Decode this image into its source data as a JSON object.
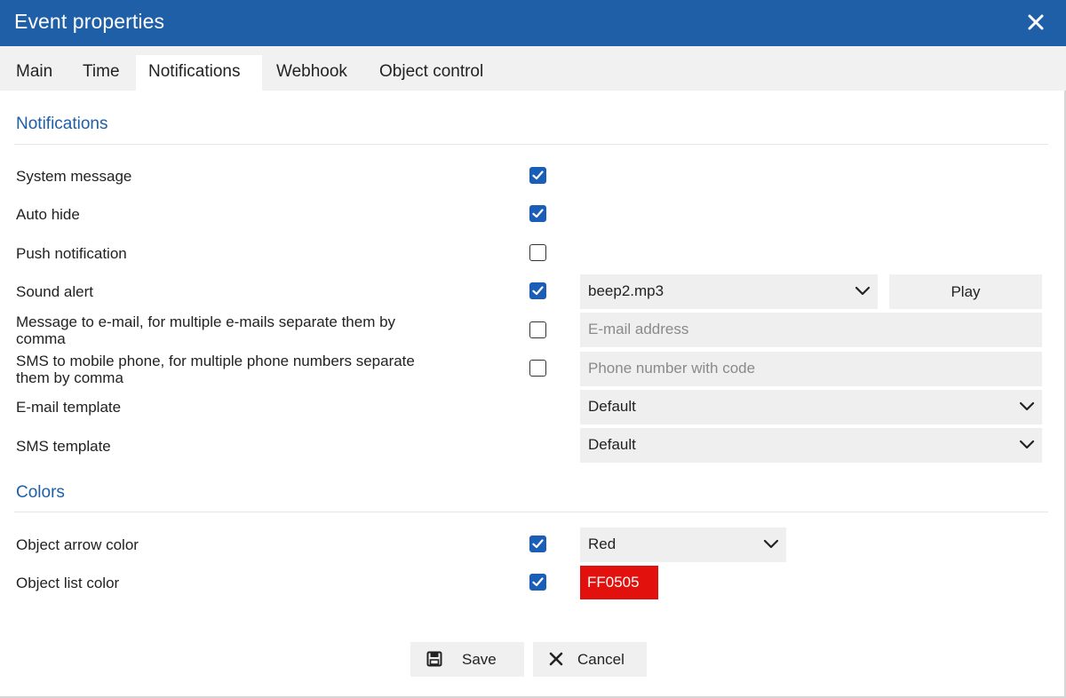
{
  "window": {
    "title": "Event properties",
    "close_icon": "close-icon",
    "titlebar_color": "#1e5fa8"
  },
  "tabs": [
    {
      "label": "Main",
      "active": false
    },
    {
      "label": "Time",
      "active": false
    },
    {
      "label": "Notifications",
      "active": true
    },
    {
      "label": "Webhook",
      "active": false
    },
    {
      "label": "Object control",
      "active": false
    }
  ],
  "notifications": {
    "section_title": "Notifications",
    "system_message": {
      "label": "System message",
      "checked": true
    },
    "auto_hide": {
      "label": "Auto hide",
      "checked": true
    },
    "push_notification": {
      "label": "Push notification",
      "checked": false
    },
    "sound_alert": {
      "label": "Sound alert",
      "checked": true,
      "sound_value": "beep2.mp3",
      "play_label": "Play"
    },
    "email": {
      "label_line1": "Message to e-mail, for multiple e-mails separate them by",
      "label_line2": "comma",
      "checked": false,
      "placeholder": "E-mail address"
    },
    "sms": {
      "label_line1": "SMS to mobile phone, for multiple phone numbers separate",
      "label_line2": "them by comma",
      "checked": false,
      "placeholder": "Phone number with code"
    },
    "email_template": {
      "label": "E-mail template",
      "value": "Default"
    },
    "sms_template": {
      "label": "SMS template",
      "value": "Default"
    }
  },
  "colors": {
    "section_title": "Colors",
    "object_arrow_color": {
      "label": "Object arrow color",
      "checked": true,
      "value": "Red"
    },
    "object_list_color": {
      "label": "Object list color",
      "checked": true,
      "value": "FF0505",
      "swatch": "#e3110d"
    }
  },
  "footer": {
    "save_label": "Save",
    "save_icon": "save-icon",
    "cancel_label": "Cancel",
    "cancel_icon": "cancel-icon"
  },
  "accent_color": "#1a5eb8"
}
